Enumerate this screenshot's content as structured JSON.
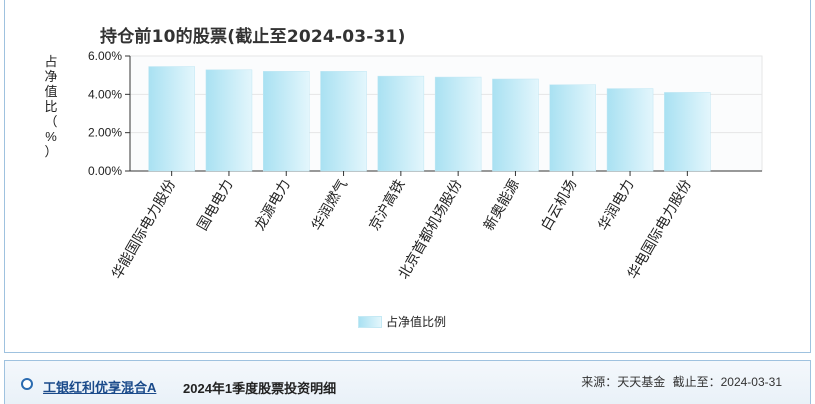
{
  "chart_data": {
    "type": "bar",
    "title": "持仓前10的股票(截止至2024-03-31)",
    "ylabel": "占\n净\n值\n比\n（\n%\n）",
    "categories": [
      "华能国际电力股份",
      "国电电力",
      "龙源电力",
      "华润燃气",
      "京沪高铁",
      "北京首都机场股份",
      "新奥能源",
      "白云机场",
      "华润电力",
      "华电国际电力股份"
    ],
    "series": [
      {
        "name": "占净值比例",
        "values": [
          5.45,
          5.28,
          5.2,
          5.2,
          4.95,
          4.9,
          4.8,
          4.5,
          4.3,
          4.1
        ]
      }
    ],
    "ylim": [
      0,
      6
    ],
    "yticks": [
      "0.00%",
      "2.00%",
      "4.00%",
      "6.00%"
    ],
    "ytick_values": [
      0,
      2,
      4,
      6
    ],
    "grid": true,
    "legend_position": "bottom-center",
    "colors": {
      "bar_light": "#e3f6fc",
      "bar_dark": "#a9e1f2",
      "grid": "#e6e6e6",
      "axis": "#333333"
    }
  },
  "footer": {
    "fund_name": "工银红利优享混合A",
    "report_title": "2024年1季度股票投资明细",
    "source_label": "来源：天天基金",
    "as_of": "截止至：2024-03-31"
  }
}
